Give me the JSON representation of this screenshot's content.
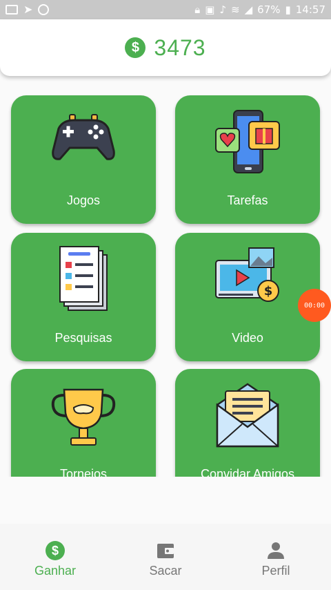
{
  "status_bar": {
    "battery": "67%",
    "time": "14:57"
  },
  "header": {
    "currency_icon": "dollar-coin-icon",
    "balance": "3473"
  },
  "cards": [
    {
      "label": "Jogos",
      "icon": "gamepad-icon"
    },
    {
      "label": "Tarefas",
      "icon": "phone-gift-icon"
    },
    {
      "label": "Pesquisas",
      "icon": "survey-checklist-icon"
    },
    {
      "label": "Video",
      "icon": "video-coin-icon"
    },
    {
      "label": "Torneios",
      "icon": "trophy-icon"
    },
    {
      "label": "Convidar Amigos",
      "icon": "envelope-letter-icon"
    }
  ],
  "timer": "00:00",
  "bottom_nav": [
    {
      "label": "Ganhar",
      "icon": "dollar-coin-icon",
      "active": true
    },
    {
      "label": "Sacar",
      "icon": "wallet-icon",
      "active": false
    },
    {
      "label": "Perfil",
      "icon": "person-icon",
      "active": false
    }
  ],
  "colors": {
    "primary": "#4caf50",
    "timer": "#ff5a1f",
    "status_bar": "#c8c8c8"
  }
}
